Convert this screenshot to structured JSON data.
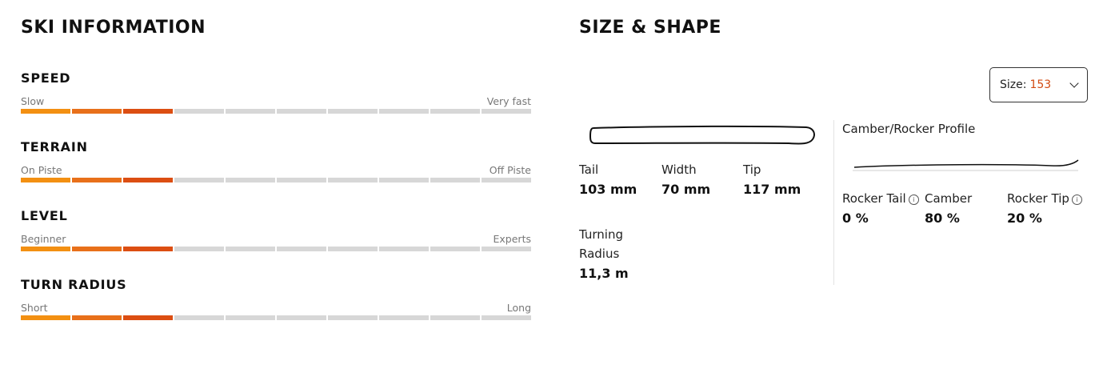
{
  "ski_info": {
    "heading": "SKI INFORMATION",
    "fill_colors": [
      "#f39012",
      "#e8701a",
      "#dc4e12"
    ],
    "empty_color": "#d7d7d7",
    "segments_total": 10,
    "metrics": [
      {
        "title": "SPEED",
        "low": "Slow",
        "high": "Very fast",
        "filled": 3
      },
      {
        "title": "TERRAIN",
        "low": "On Piste",
        "high": "Off Piste",
        "filled": 3
      },
      {
        "title": "LEVEL",
        "low": "Beginner",
        "high": "Experts",
        "filled": 3
      },
      {
        "title": "TURN RADIUS",
        "low": "Short",
        "high": "Long",
        "filled": 3
      }
    ]
  },
  "size_shape": {
    "heading": "SIZE & SHAPE",
    "size_select": {
      "label": "Size:",
      "value": "153",
      "accent": "#d24a12"
    },
    "dimensions": {
      "tail": {
        "label": "Tail",
        "value": "103 mm"
      },
      "width": {
        "label": "Width",
        "value": "70 mm"
      },
      "tip": {
        "label": "Tip",
        "value": "117 mm"
      },
      "turning_radius": {
        "label_line1": "Turning",
        "label_line2": "Radius",
        "value": "11,3 m"
      }
    },
    "profile": {
      "title": "Camber/Rocker Profile",
      "rocker_tail": {
        "label": "Rocker Tail",
        "value": "0 %",
        "icon": "info-icon"
      },
      "camber": {
        "label": "Camber",
        "value": "80 %"
      },
      "rocker_tip": {
        "label": "Rocker Tip",
        "value": "20 %",
        "icon": "info-icon"
      }
    }
  }
}
